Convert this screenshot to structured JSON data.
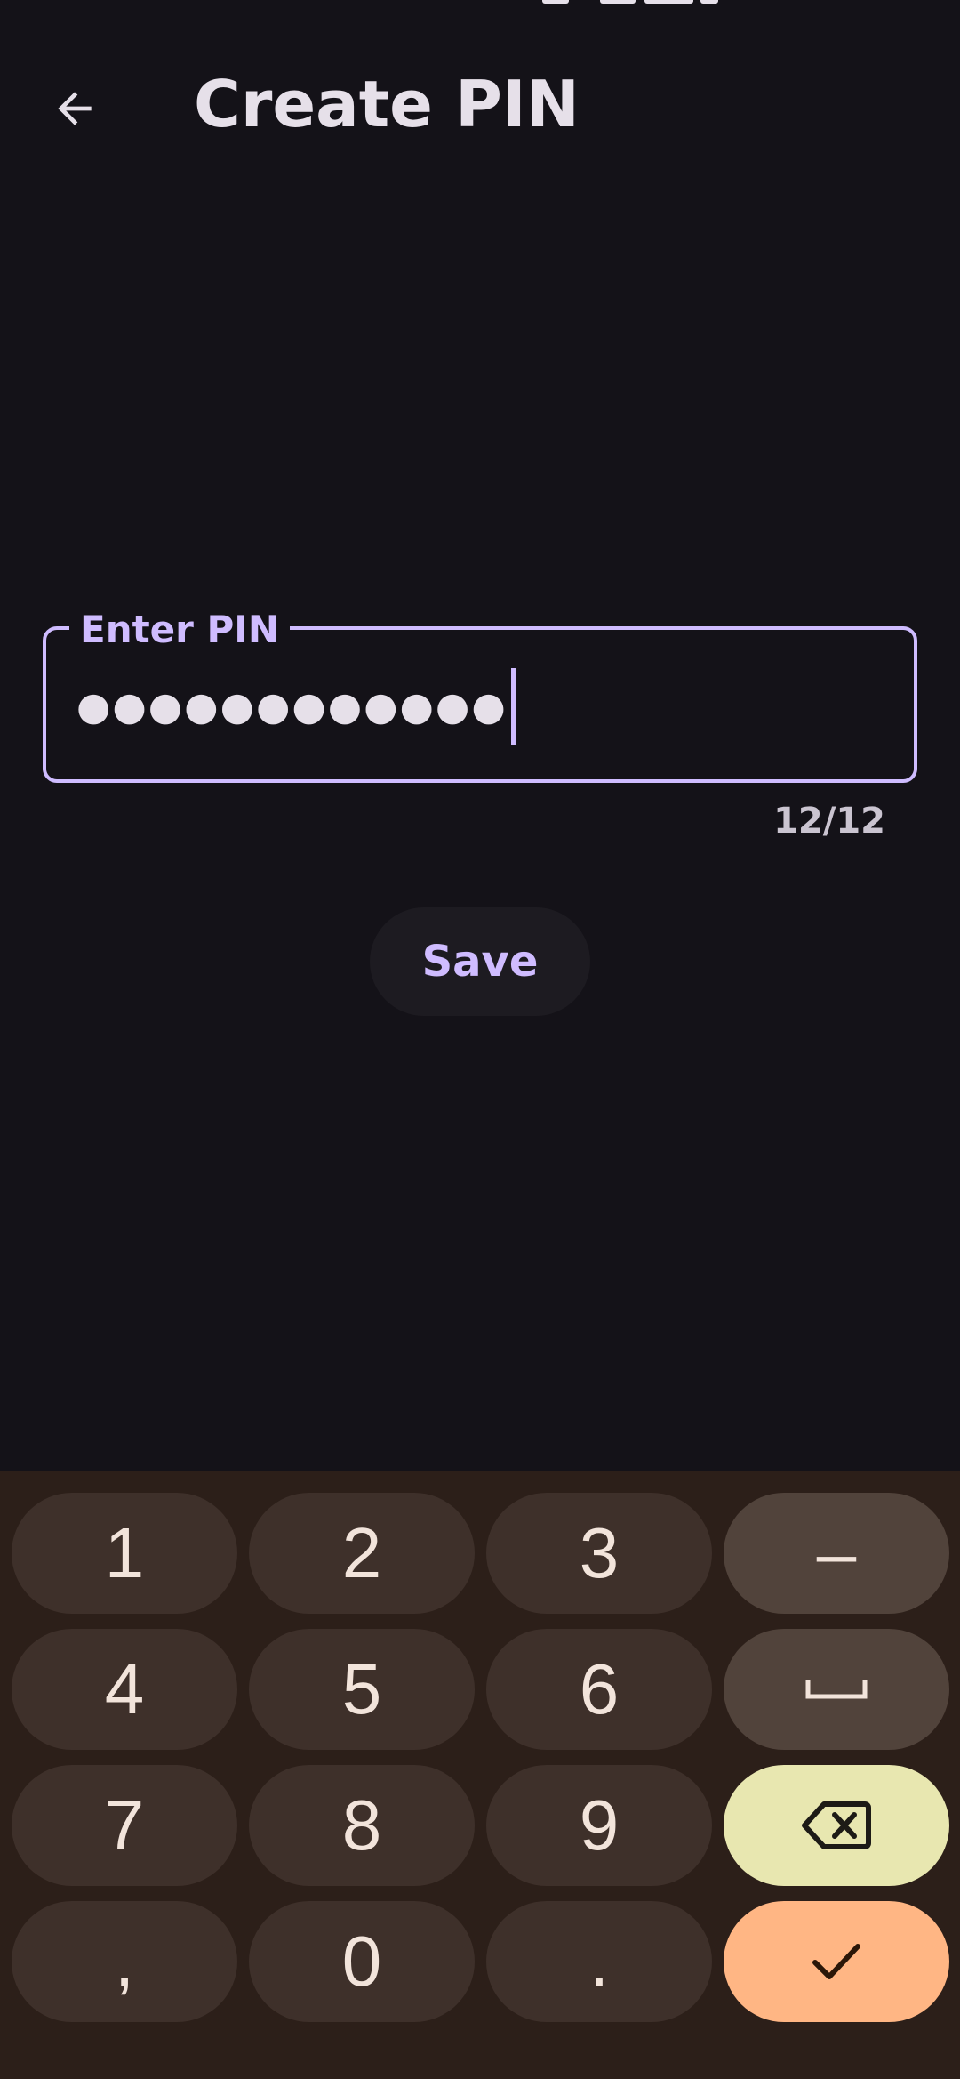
{
  "header": {
    "title": "Create PIN",
    "back_icon": "arrow-back-icon"
  },
  "pin_field": {
    "label": "Enter PIN",
    "masked_value": "●●●●●●●●●●●●",
    "counter": "12/12"
  },
  "save_label": "Save",
  "colors": {
    "background": "#141218",
    "accent": "#cfbcff",
    "keyboard_bg": "#2c1f19",
    "key_bg": "#3e302a",
    "function_key_bg": "#51433b",
    "backspace_key_bg": "#e8e7b0",
    "enter_key_bg": "#ffb684"
  },
  "keyboard": {
    "keys": [
      {
        "label": "1",
        "icon": ""
      },
      {
        "label": "2",
        "icon": ""
      },
      {
        "label": "3",
        "icon": ""
      },
      {
        "label": "–",
        "icon": ""
      },
      {
        "label": "4",
        "icon": ""
      },
      {
        "label": "5",
        "icon": ""
      },
      {
        "label": "6",
        "icon": ""
      },
      {
        "label": "",
        "icon": "space-icon"
      },
      {
        "label": "7",
        "icon": ""
      },
      {
        "label": "8",
        "icon": ""
      },
      {
        "label": "9",
        "icon": ""
      },
      {
        "label": "",
        "icon": "backspace-icon"
      },
      {
        "label": ",",
        "icon": ""
      },
      {
        "label": "0",
        "icon": ""
      },
      {
        "label": ".",
        "icon": ""
      },
      {
        "label": "",
        "icon": "check-icon"
      }
    ]
  }
}
